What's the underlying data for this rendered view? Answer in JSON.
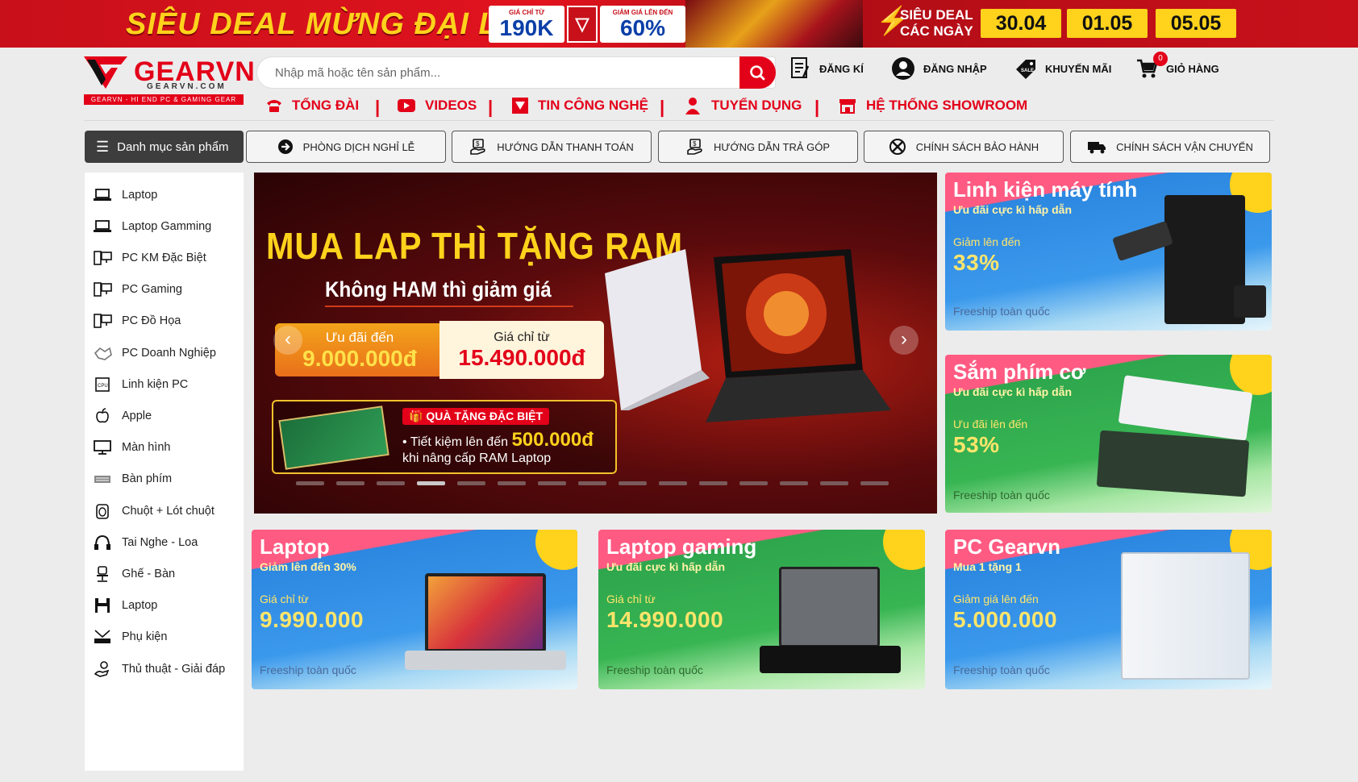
{
  "top_banner": {
    "headline": "SIÊU DEAL MỪNG ĐẠI LỄ",
    "price_chip": {
      "small": "GIÁ CHỈ TỪ",
      "big": "190K"
    },
    "discount_chip": {
      "small": "GIẢM GIÁ LÊN ĐẾN",
      "big": "60%"
    },
    "daily_line1": "SIÊU DEAL",
    "daily_line2": "CÁC NGÀY",
    "dates": [
      "30.04",
      "01.05",
      "05.05"
    ]
  },
  "logo": {
    "name": "GEARVN",
    "domain": "GEARVN.COM",
    "tagline": "GEARVN - HI END PC & GAMING GEAR"
  },
  "search": {
    "placeholder": "Nhập mã hoặc tên sản phẩm..."
  },
  "header_links": {
    "register": "ĐĂNG KÍ",
    "login": "ĐĂNG NHẬP",
    "promo": "KHUYẾN MÃI",
    "cart": "GIỎ HÀNG",
    "cart_count": "0"
  },
  "nav": [
    "TỔNG ĐÀI",
    "VIDEOS",
    "TIN CÔNG NGHỆ",
    "TUYỂN DỤNG",
    "HỆ THỐNG SHOWROOM"
  ],
  "category_button": "Danh mục sản phẩm",
  "policies": [
    "PHÒNG DỊCH NGHỈ LỄ",
    "HƯỚNG DẪN THANH TOÁN",
    "HƯỚNG DẪN TRẢ GÓP",
    "CHÍNH SÁCH BẢO HÀNH",
    "CHÍNH SÁCH VẬN CHUYỂN"
  ],
  "sidebar": [
    {
      "label": "Laptop",
      "icon": "laptop-icon"
    },
    {
      "label": "Laptop Gamming",
      "icon": "laptop-icon"
    },
    {
      "label": "PC KM Đặc Biệt",
      "icon": "desktop-pc-icon"
    },
    {
      "label": "PC Gaming",
      "icon": "desktop-pc-icon"
    },
    {
      "label": "PC Đồ Họa",
      "icon": "desktop-pc-icon"
    },
    {
      "label": "PC Doanh Nghiệp",
      "icon": "handshake-icon"
    },
    {
      "label": "Linh kiện PC",
      "icon": "cpu-icon"
    },
    {
      "label": "Apple",
      "icon": "apple-icon"
    },
    {
      "label": "Màn hình",
      "icon": "monitor-icon"
    },
    {
      "label": "Bàn phím",
      "icon": "keyboard-icon"
    },
    {
      "label": "Chuột + Lót chuột",
      "icon": "mouse-icon"
    },
    {
      "label": "Tai Nghe - Loa",
      "icon": "headphones-icon"
    },
    {
      "label": "Ghế - Bàn",
      "icon": "chair-icon"
    },
    {
      "label": "Laptop",
      "icon": "save-icon"
    },
    {
      "label": "Phụ kiện",
      "icon": "accessory-icon"
    },
    {
      "label": "Thủ thuật - Giải đáp",
      "icon": "tips-icon"
    }
  ],
  "hero": {
    "title": "MUA LAP THÌ TẶNG RAM",
    "subtitle": "Không HAM thì giảm giá",
    "offer_label": "Ưu đãi đến",
    "offer_value": "9.000.000đ",
    "price_label": "Giá chỉ từ",
    "price_value": "15.490.000đ",
    "gift_tag": "QUÀ TẶNG ĐẶC BIỆT",
    "gift_line1_prefix": "• Tiết kiệm lên đến",
    "gift_line1_value": "500.000đ",
    "gift_line2": "khi nâng cấp RAM Laptop",
    "slide_count": 15,
    "active_slide": 3
  },
  "side_cards": [
    {
      "title": "Linh kiện máy tính",
      "subtitle": "Ưu đãi cực kì hấp dẫn",
      "label": "Giảm lên đến",
      "value": "33%",
      "footer": "Freeship toàn quốc",
      "theme": "blue"
    },
    {
      "title": "Sắm phím cơ",
      "subtitle": "Ưu đãi cực kì hấp dẫn",
      "label": "Ưu đãi lên đến",
      "value": "53%",
      "footer": "Freeship toàn quốc",
      "theme": "green"
    }
  ],
  "bottom_cards": [
    {
      "title": "Laptop",
      "subtitle": "Giảm lên đến 30%",
      "label": "Giá chỉ từ",
      "value": "9.990.000",
      "footer": "Freeship toàn quốc",
      "theme": "blue"
    },
    {
      "title": "Laptop gaming",
      "subtitle": "Ưu đãi cực kì hấp dẫn",
      "label": "Giá chỉ từ",
      "value": "14.990.000",
      "footer": "Freeship toàn quốc",
      "theme": "green"
    },
    {
      "title": "PC Gearvn",
      "subtitle": "Mua 1 tặng 1",
      "label": "Giảm giá lên đến",
      "value": "5.000.000",
      "footer": "Freeship toàn quốc",
      "theme": "blue"
    }
  ],
  "colors": {
    "brand_red": "#e30019",
    "promo_yellow": "#ffd21c",
    "dark_button": "#3d3d3d"
  }
}
